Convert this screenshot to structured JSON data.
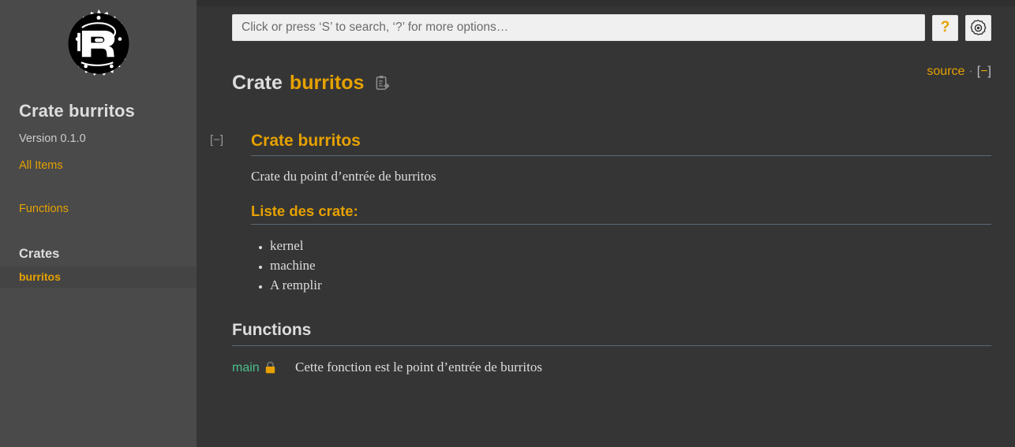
{
  "sidebar": {
    "logo_icon": "rust-logo",
    "crate_title": "Crate burritos",
    "version": "Version 0.1.0",
    "all_items_label": "All Items",
    "functions_label": "Functions",
    "crates_block_title": "Crates",
    "crate_items": [
      {
        "label": "burritos",
        "current": true
      }
    ]
  },
  "search": {
    "placeholder": "Click or press ‘S’ to search, ‘?’ for more options…",
    "value": "",
    "help_label": "?",
    "settings_icon": "gear-icon"
  },
  "header": {
    "kind": "Crate",
    "name": "burritos",
    "copy_icon": "copy-path-icon",
    "source_label": "source",
    "separator": "·",
    "toggle_open": "[",
    "toggle_minus": "−",
    "toggle_close": "]"
  },
  "doc": {
    "collapse_toggle": "[−]",
    "heading": "Crate burritos",
    "paragraph": "Crate du point d’entrée de burritos",
    "subheading": "Liste des crate:",
    "list": [
      "kernel",
      "machine",
      "A remplir"
    ]
  },
  "functions_section": {
    "heading": "Functions",
    "items": [
      {
        "name": "main",
        "visibility_icon": "lock-icon",
        "description": "Cette fonction est le point d’entrée de burritos"
      }
    ]
  },
  "colors": {
    "accent_orange": "#e6a100",
    "fn_green": "#4ebd90",
    "sidebar_bg": "#4a4a4a",
    "main_bg": "#353535",
    "rule": "#5c6773"
  }
}
